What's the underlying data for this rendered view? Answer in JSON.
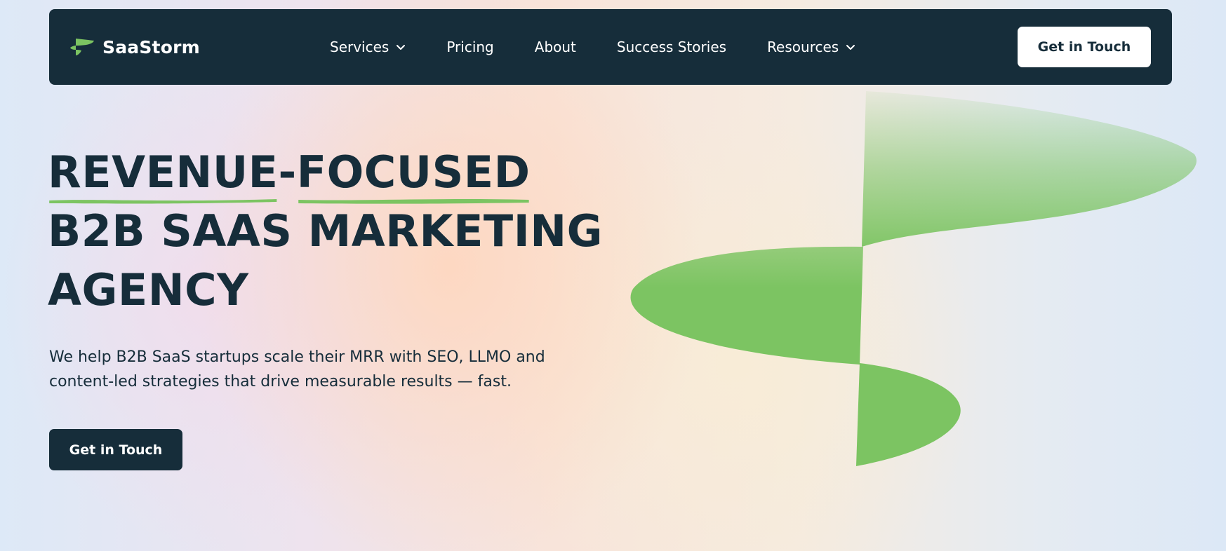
{
  "brand": {
    "name": "SaaStorm",
    "logo_icon": "saastorm-logo-icon"
  },
  "nav": {
    "items": [
      {
        "label": "Services",
        "has_dropdown": true
      },
      {
        "label": "Pricing",
        "has_dropdown": false
      },
      {
        "label": "About",
        "has_dropdown": false
      },
      {
        "label": "Success Stories",
        "has_dropdown": false
      },
      {
        "label": "Resources",
        "has_dropdown": true
      }
    ],
    "cta_label": "Get in Touch"
  },
  "hero": {
    "title_word_1": "REVENUE",
    "title_dash": "-",
    "title_word_2": "FOCUSED",
    "title_line_2": "B2B SAAS MARKETING",
    "title_line_3": "AGENCY",
    "subtitle": "We help B2B SaaS startups scale their MRR with SEO, LLMO and content-led strategies that drive measurable results — fast.",
    "cta_label": "Get in Touch"
  },
  "colors": {
    "navy": "#162d3a",
    "green": "#7cc462",
    "white": "#ffffff"
  }
}
